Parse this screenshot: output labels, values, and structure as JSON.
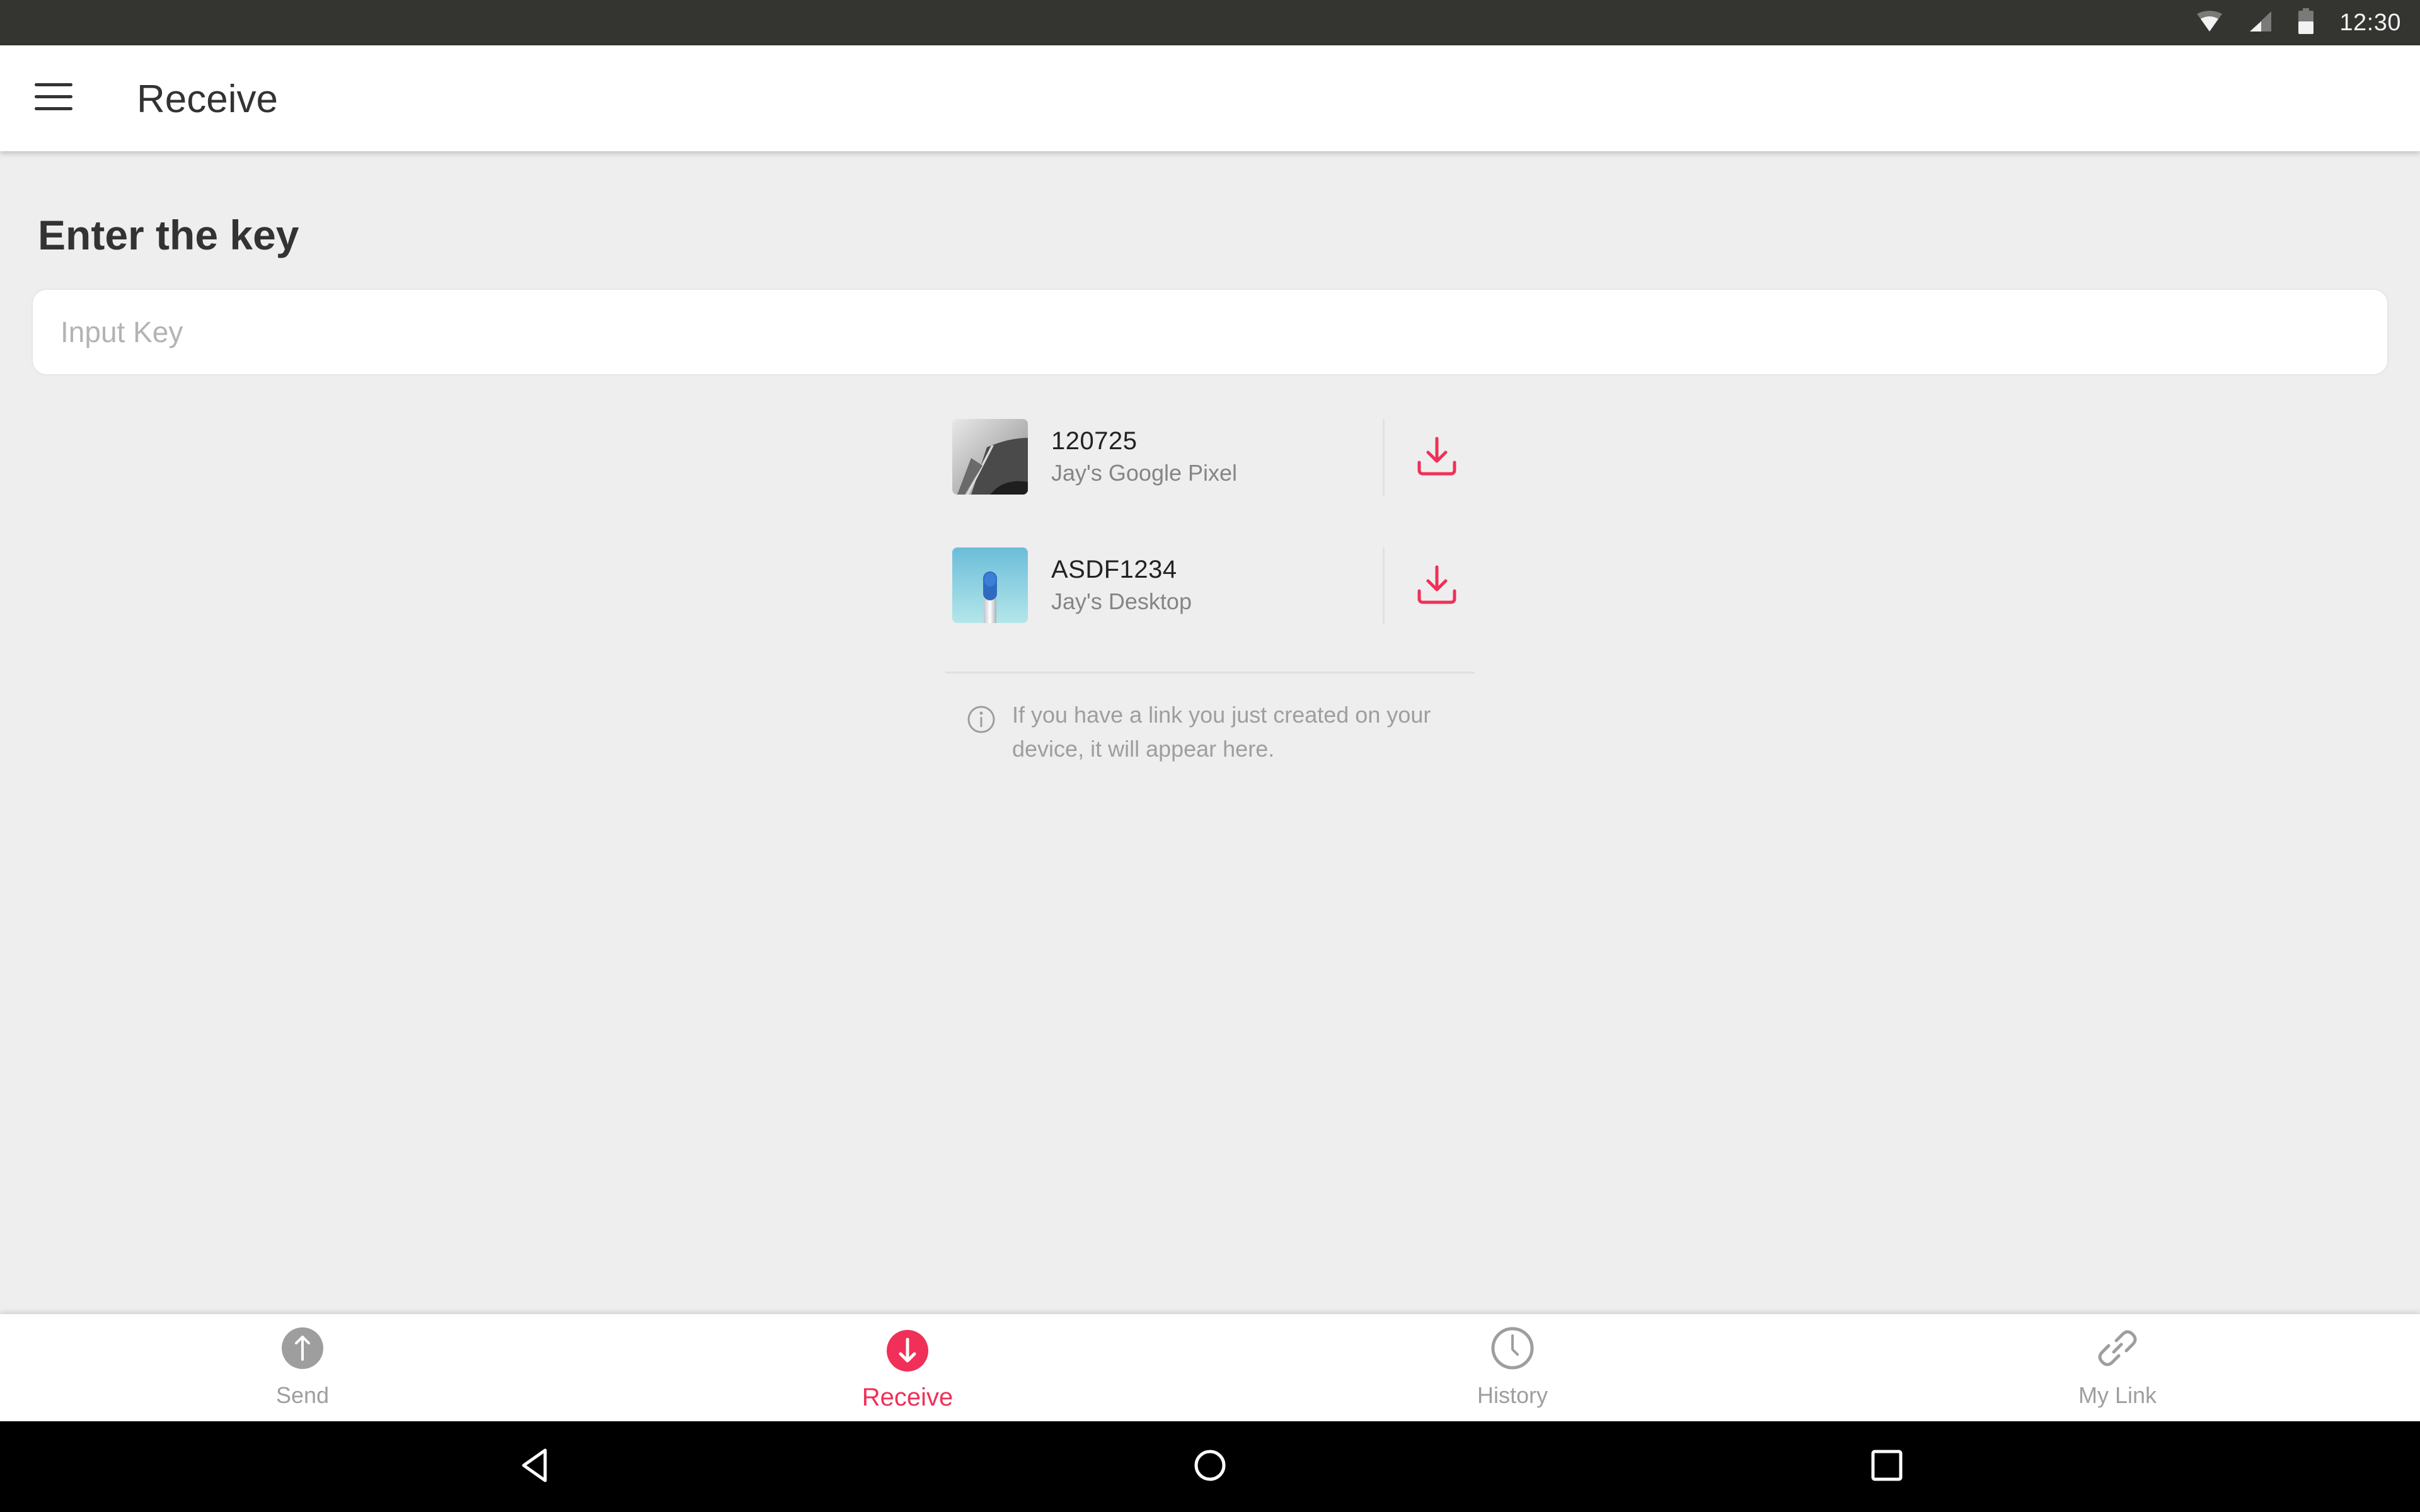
{
  "status_bar": {
    "time": "12:30",
    "icons": [
      "wifi-icon",
      "cellular-signal-icon",
      "battery-icon"
    ]
  },
  "app_bar": {
    "menu_icon": "hamburger-menu-icon",
    "title": "Receive"
  },
  "receive": {
    "heading": "Enter the key",
    "input": {
      "placeholder": "Input Key",
      "value": ""
    },
    "links": [
      {
        "key": "120725",
        "device": "Jay's Google Pixel",
        "thumbnail": "grayscale-architecture-image",
        "action_icon": "download-icon"
      },
      {
        "key": "ASDF1234",
        "device": "Jay's Desktop",
        "thumbnail": "blue-object-on-sky-image",
        "action_icon": "download-icon"
      }
    ],
    "info_icon": "info-icon",
    "info_text": "If you have a link you just created on your device, it will appear here."
  },
  "bottom_nav": {
    "items": [
      {
        "label": "Send",
        "icon": "upload-circle-icon",
        "active": false
      },
      {
        "label": "Receive",
        "icon": "download-circle-icon",
        "active": true
      },
      {
        "label": "History",
        "icon": "clock-icon",
        "active": false
      },
      {
        "label": "My Link",
        "icon": "link-icon",
        "active": false
      }
    ]
  },
  "system_nav": {
    "buttons": [
      "back-icon",
      "home-icon",
      "recents-icon"
    ]
  },
  "colors": {
    "accent": "#f03058",
    "status_bar": "#343431",
    "background": "#eeeeee",
    "inactive": "#9e9e9e"
  }
}
